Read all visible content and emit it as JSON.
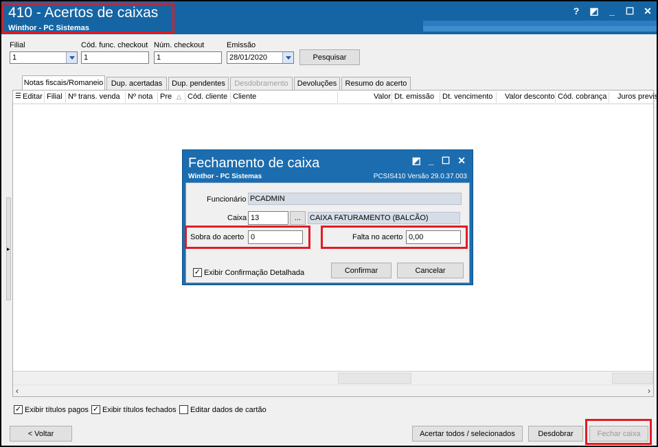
{
  "window": {
    "title": "410 - Acertos de caixas",
    "subtitle": "Winthor - PC Sistemas",
    "controls": [
      "?",
      "◩",
      "_",
      "☐",
      "✕"
    ]
  },
  "filters": {
    "filial_label": "Filial",
    "filial_value": "1",
    "cod_func_label": "Cód. func. checkout",
    "cod_func_value": "1",
    "num_checkout_label": "Núm. checkout",
    "num_checkout_value": "1",
    "emissao_label": "Emissão",
    "emissao_value": "28/01/2020",
    "search_button": "Pesquisar"
  },
  "tabs": [
    {
      "label": "Notas fiscais/Romaneio",
      "active": true,
      "enabled": true
    },
    {
      "label": "Dup. acertadas",
      "active": false,
      "enabled": true
    },
    {
      "label": "Dup. pendentes",
      "active": false,
      "enabled": true
    },
    {
      "label": "Desdobramento",
      "active": false,
      "enabled": false
    },
    {
      "label": "Devoluções",
      "active": false,
      "enabled": true
    },
    {
      "label": "Resumo do acerto",
      "active": false,
      "enabled": true
    }
  ],
  "grid": {
    "columns": [
      "Editar",
      "Filial",
      "Nº trans. venda",
      "Nº nota",
      "Pre",
      "Cód. cliente",
      "Cliente",
      "Valor",
      "Dt. emissão",
      "Dt. vencimento",
      "Valor desconto",
      "Cód. cobrança",
      "Juros previs"
    ],
    "sort_icon": "sort-asc-icon"
  },
  "checkboxes": [
    {
      "label": "Exibir títulos pagos",
      "checked": true
    },
    {
      "label": "Exibir títulos fechados",
      "checked": true
    },
    {
      "label": "Editar dados de cartão",
      "checked": false
    }
  ],
  "footer": {
    "back_button": "< Voltar",
    "settle_button": "Acertar todos / selecionados",
    "split_button": "Desdobrar",
    "close_cash_button": "Fechar caixa"
  },
  "dialog": {
    "title": "Fechamento de caixa",
    "subtitle": "Winthor - PC Sistemas",
    "version": "PCSIS410  Versão  29.0.37.003",
    "controls": [
      "◩",
      "_",
      "☐",
      "✕"
    ],
    "funcionario_label": "Funcionário",
    "funcionario_value": "PCADMIN",
    "caixa_label": "Caixa",
    "caixa_value": "13",
    "caixa_button": "...",
    "caixa_desc": "CAIXA FATURAMENTO (BALCÃO)",
    "sobra_label": "Sobra do acerto",
    "sobra_value": "0",
    "falta_label": "Falta no acerto",
    "falta_value": "0,00",
    "confirm_detail_label": "Exibir Confirmação Detalhada",
    "confirm_detail_checked": true,
    "confirm_button": "Confirmar",
    "cancel_button": "Cancelar"
  },
  "colors": {
    "titlebar": "#1565a5",
    "highlight": "#e01b24"
  }
}
